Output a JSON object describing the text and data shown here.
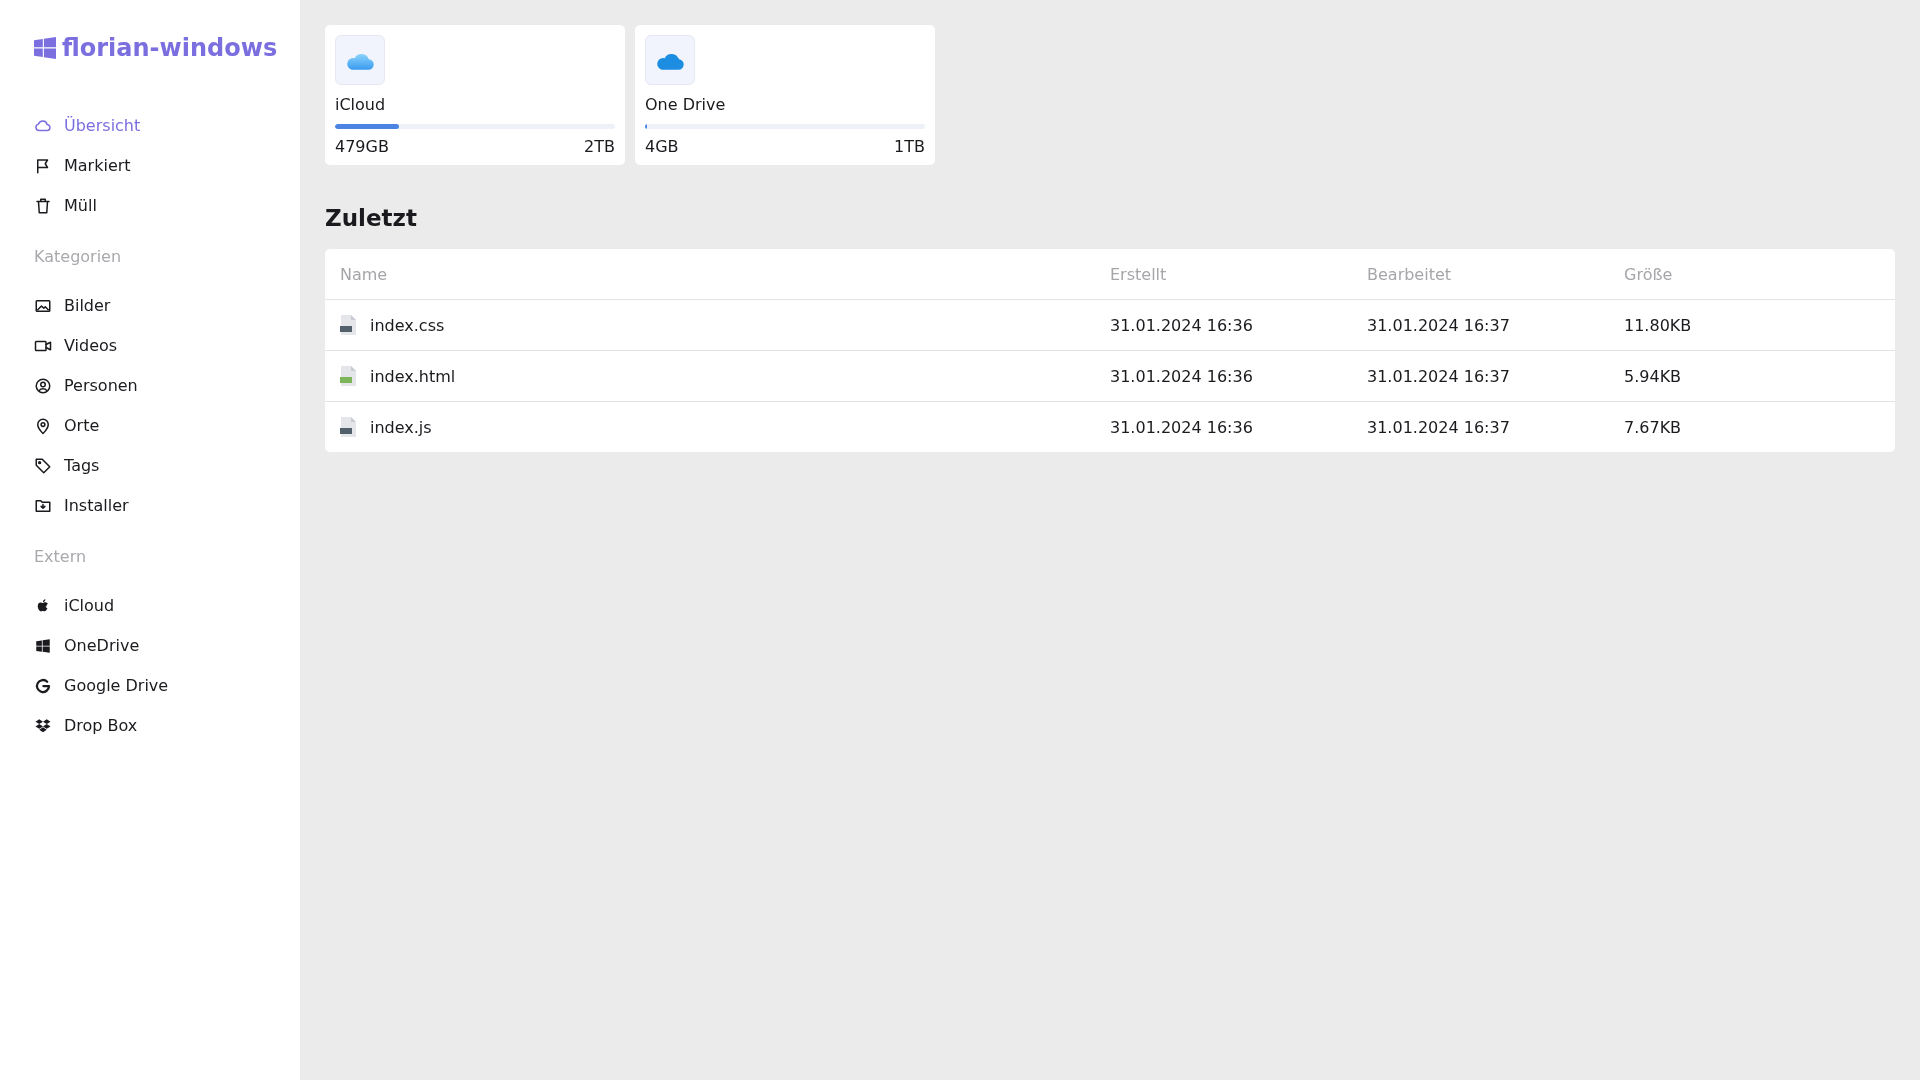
{
  "logo": {
    "text": "florian-windows"
  },
  "sidebar": {
    "groups": [
      {
        "items": [
          {
            "label": "Übersicht",
            "kind": "cloud",
            "selected": true
          },
          {
            "label": "Markiert",
            "kind": "flag",
            "selected": false
          },
          {
            "label": "Müll",
            "kind": "trash",
            "selected": false
          }
        ]
      },
      {
        "heading": "Kategorien",
        "items": [
          {
            "label": "Bilder",
            "kind": "image",
            "selected": false
          },
          {
            "label": "Videos",
            "kind": "video",
            "selected": false
          },
          {
            "label": "Personen",
            "kind": "person",
            "selected": false
          },
          {
            "label": "Orte",
            "kind": "pin",
            "selected": false
          },
          {
            "label": "Tags",
            "kind": "tag",
            "selected": false
          },
          {
            "label": "Installer",
            "kind": "folder",
            "selected": false
          }
        ]
      },
      {
        "heading": "Extern",
        "items": [
          {
            "label": "iCloud",
            "kind": "apple",
            "selected": false
          },
          {
            "label": "OneDrive",
            "kind": "windows",
            "selected": false
          },
          {
            "label": "Google Drive",
            "kind": "google",
            "selected": false
          },
          {
            "label": "Drop Box",
            "kind": "dropbox",
            "selected": false
          }
        ]
      }
    ]
  },
  "storage": [
    {
      "name": "iCloud",
      "kind": "icloud",
      "level": 0.23,
      "used": "479GB",
      "total": "2TB"
    },
    {
      "name": "One Drive",
      "kind": "onedrive",
      "level": 0.004,
      "used": "4GB",
      "total": "1TB"
    }
  ],
  "recent": {
    "title": "Zuletzt",
    "columns": [
      "Name",
      "Erstellt",
      "Bearbeitet",
      "Größe"
    ],
    "rows": [
      {
        "kind": "css",
        "name": "index.css",
        "created": "31.01.2024 16:36",
        "edited": "31.01.2024 16:37",
        "size": "11.80KB"
      },
      {
        "kind": "html",
        "name": "index.html",
        "created": "31.01.2024 16:36",
        "edited": "31.01.2024 16:37",
        "size": "5.94KB"
      },
      {
        "kind": "js",
        "name": "index.js",
        "created": "31.01.2024 16:36",
        "edited": "31.01.2024 16:37",
        "size": "7.67KB"
      }
    ]
  }
}
